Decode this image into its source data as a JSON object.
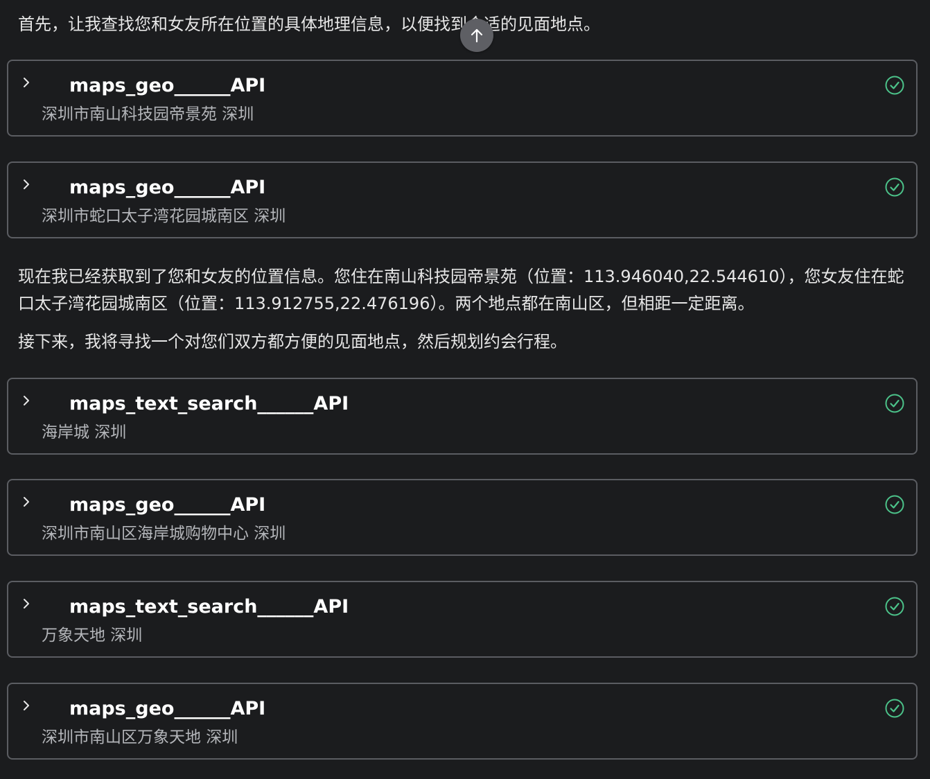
{
  "messages": {
    "intro": "首先，让我查找您和女友所在位置的具体地理信息，以便找到合适的见面地点。",
    "location_summary": "现在我已经获取到了您和女友的位置信息。您住在南山科技园帝景苑（位置：113.946040,22.544610），您女友住在蛇口太子湾花园城南区（位置：113.912755,22.476196）。两个地点都在南山区，但相距一定距离。",
    "next_step": "接下来，我将寻找一个对您们双方都方便的见面地点，然后规划约会行程。"
  },
  "tool_calls": [
    {
      "name": "maps_geo______API",
      "args": "深圳市南山科技园帝景苑 深圳",
      "status": "success",
      "status_icon": "check-circle-icon"
    },
    {
      "name": "maps_geo______API",
      "args": "深圳市蛇口太子湾花园城南区 深圳",
      "status": "success",
      "status_icon": "check-circle-icon"
    },
    {
      "name": "maps_text_search______API",
      "args": "海岸城 深圳",
      "status": "success",
      "status_icon": "check-circle-icon"
    },
    {
      "name": "maps_geo______API",
      "args": "深圳市南山区海岸城购物中心 深圳",
      "status": "success",
      "status_icon": "check-circle-icon"
    },
    {
      "name": "maps_text_search______API",
      "args": "万象天地 深圳",
      "status": "success",
      "status_icon": "check-circle-icon"
    },
    {
      "name": "maps_geo______API",
      "args": "深圳市南山区万象天地 深圳",
      "status": "success",
      "status_icon": "check-circle-icon"
    }
  ],
  "scroll_top_icon": "arrow-up-icon",
  "colors": {
    "background": "#1b1c1e",
    "card_border": "#5b5d62",
    "success": "#4cc38a",
    "scroll_button": "#5e5f64"
  }
}
